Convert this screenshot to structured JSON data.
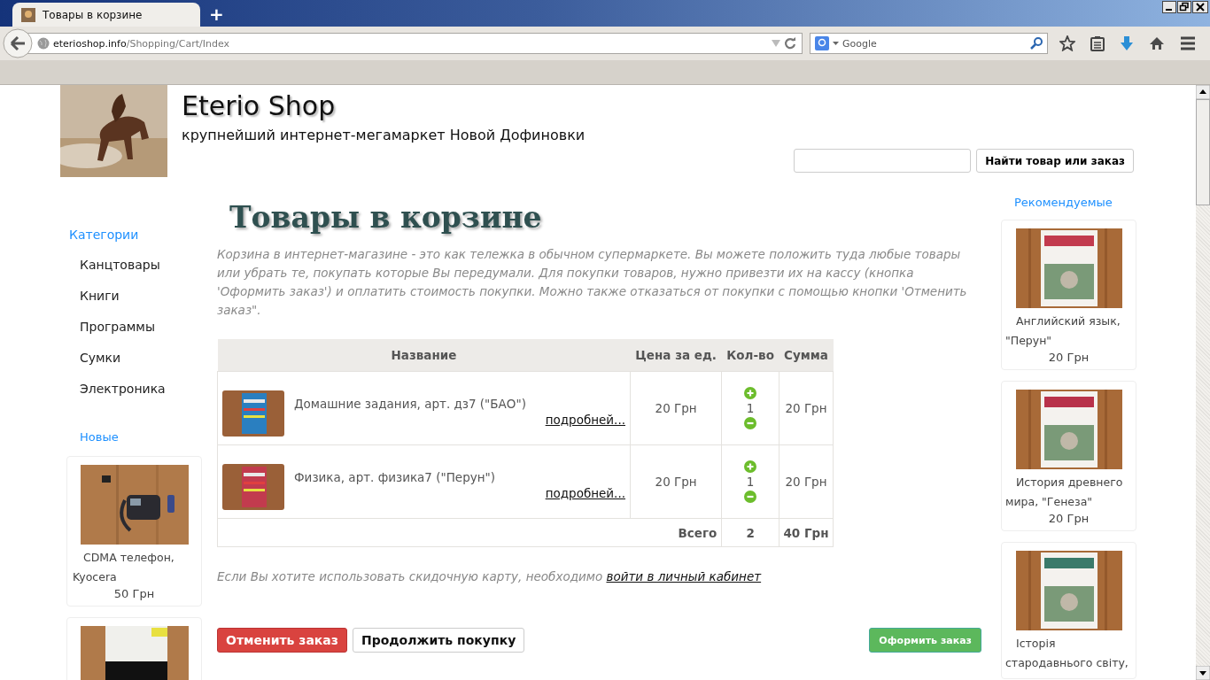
{
  "browser": {
    "tab_title": "Товары в корзине",
    "new_tab": "+",
    "url_host": "eterioshop.info",
    "url_path": "/Shopping/Cart/Index",
    "search_placeholder": "Google"
  },
  "header": {
    "title": "Eterio Shop",
    "subtitle": "крупнейший интернет-мегамаркет Новой Дофиновки",
    "search_button": "Найти товар или заказ"
  },
  "sidebar": {
    "categories_title": "Категории",
    "categories": [
      "Канцтовары",
      "Книги",
      "Программы",
      "Сумки",
      "Электроника"
    ],
    "new_title": "Новые",
    "new_items": [
      {
        "name": "CDMA телефон, Kyocera",
        "price": "50 Грн",
        "kind": "phone"
      },
      {
        "kind": "book"
      }
    ]
  },
  "main": {
    "heading": "Товары в корзине",
    "intro": "Корзина в интернет-магазине - это как тележка в обычном супермаркете. Вы можете положить туда любые товары или убрать те, покупать которые Вы передумали. Для покупки товаров, нужно привезти их на кассу (кнопка 'Оформить заказ') и оплатить стоимость покупки. Можно также отказаться от покупки с помощью кнопки 'Отменить заказ\".",
    "columns": [
      "Название",
      "Цена за ед.",
      "Кол-во",
      "Сумма"
    ],
    "rows": [
      {
        "name": "Домашние задания, арт. дз7 (\"БАО\")",
        "more": "подробней...",
        "price": "20 Грн",
        "qty": "1",
        "sum": "20 Грн"
      },
      {
        "name": "Физика, арт. физика7 (\"Перун\")",
        "more": "подробней...",
        "price": "20 Грн",
        "qty": "1",
        "sum": "20 Грн"
      }
    ],
    "total": {
      "label": "Всего",
      "qty": "2",
      "sum": "40 Грн"
    },
    "discount_text": "Если Вы хотите использовать скидочную карту, необходимо",
    "discount_link": "войти в личный кабинет",
    "buttons": {
      "cancel": "Отменить заказ",
      "continue": "Продолжить покупку",
      "checkout": "Оформить заказ"
    }
  },
  "recommended": {
    "title": "Рекомендуемые",
    "items": [
      {
        "name": "Английский язык, \"Перун\"",
        "price": "20 Грн"
      },
      {
        "name": "История древнего мира, \"Генеза\"",
        "price": "20 Грн"
      },
      {
        "name": "Історія стародавнього світу,"
      }
    ]
  }
}
